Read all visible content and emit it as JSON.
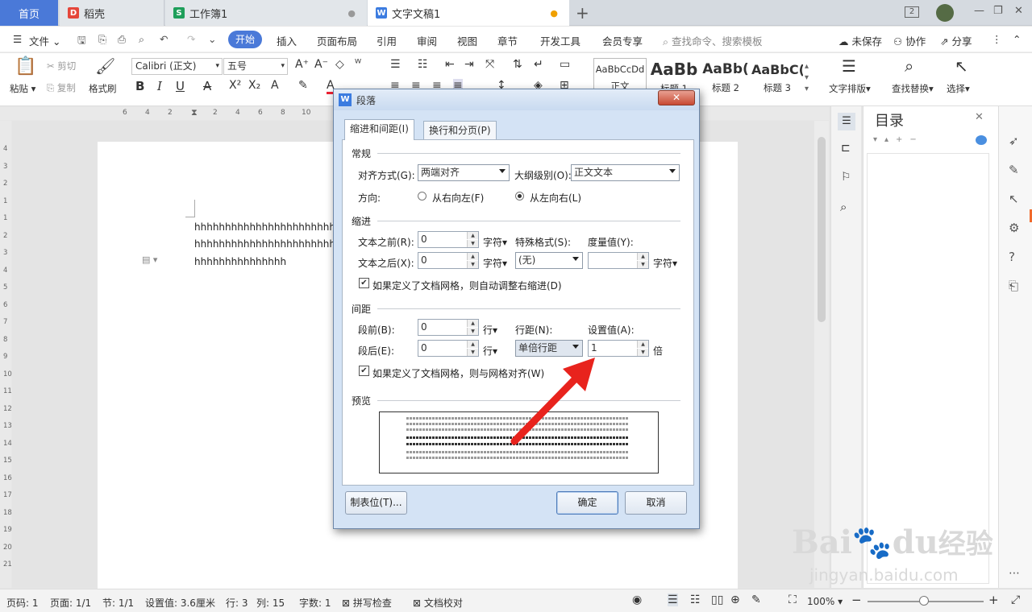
{
  "tabs": {
    "home": "首页",
    "daoke": "稻壳",
    "sheet": "工作簿1",
    "doc": "文字文稿1",
    "window_badge": "2"
  },
  "menubar": {
    "file": "文件",
    "items": [
      "开始",
      "插入",
      "页面布局",
      "引用",
      "审阅",
      "视图",
      "章节",
      "开发工具",
      "会员专享"
    ],
    "search": "查找命令、搜索模板",
    "unsaved": "未保存",
    "collab": "协作",
    "share": "分享"
  },
  "ribbon": {
    "paste": "粘贴",
    "cut": "剪切",
    "copy": "复制",
    "format_painter": "格式刷",
    "font_name": "Calibri (正文)",
    "font_size": "五号",
    "styles": [
      {
        "sample": "AaBbCcDd",
        "name": "正文"
      },
      {
        "sample": "AaBb",
        "name": "标题 1"
      },
      {
        "sample": "AaBb(",
        "name": "标题 2"
      },
      {
        "sample": "AaBbC(",
        "name": "标题 3"
      }
    ],
    "text_layout": "文字排版",
    "find_replace": "查找替换",
    "select": "选择"
  },
  "ruler": {
    "h_ticks": [
      "6",
      "4",
      "2",
      "2",
      "4",
      "6",
      "8",
      "10"
    ],
    "v_ticks": [
      "4",
      "3",
      "2",
      "1",
      "1",
      "2",
      "3",
      "4",
      "5",
      "6",
      "7",
      "8",
      "9",
      "10",
      "11",
      "12",
      "13",
      "14",
      "15",
      "16",
      "17",
      "18",
      "19",
      "20",
      "21"
    ]
  },
  "document": {
    "lines": [
      "hhhhhhhhhhhhhhhhhhhhhhhhh",
      "hhhhhhhhhhhhhhhhhhhhhhhhh",
      "hhhhhhhhhhhhhhh"
    ]
  },
  "toc": {
    "title": "目录"
  },
  "dialog": {
    "title": "段落",
    "tab1": "缩进和间距(I)",
    "tab2": "换行和分页(P)",
    "general": "常规",
    "align_label": "对齐方式(G):",
    "align_value": "两端对齐",
    "outline_label": "大纲级别(O):",
    "outline_value": "正文文本",
    "direction_label": "方向:",
    "rtl": "从右向左(F)",
    "ltr": "从左向右(L)",
    "indent": "缩进",
    "before_text_label": "文本之前(R):",
    "before_text_value": "0",
    "after_text_label": "文本之后(X):",
    "after_text_value": "0",
    "unit_char": "字符",
    "special_label": "特殊格式(S):",
    "special_value": "(无)",
    "measure_label": "度量值(Y):",
    "measure_value": "",
    "grid_indent": "如果定义了文档网格，则自动调整右缩进(D)",
    "spacing": "间距",
    "space_before_label": "段前(B):",
    "space_before_value": "0",
    "space_after_label": "段后(E):",
    "space_after_value": "0",
    "unit_line": "行",
    "line_spacing_label": "行距(N):",
    "line_spacing_value": "单倍行距",
    "setting_label": "设置值(A):",
    "setting_value": "1",
    "unit_times": "倍",
    "grid_align": "如果定义了文档网格，则与网格对齐(W)",
    "preview": "预览",
    "tabs_button": "制表位(T)...",
    "ok": "确定",
    "cancel": "取消"
  },
  "status": {
    "page_no": "页码: 1",
    "pages": "页面: 1/1",
    "section": "节: 1/1",
    "setting": "设置值: 3.6厘米",
    "row": "行: 3",
    "col": "列: 15",
    "words": "字数: 1",
    "spell": "拼写检查",
    "proof": "文档校对",
    "zoom": "100%"
  },
  "watermark": {
    "brand": "Bai",
    "brand2": "du",
    "cn": "经验",
    "url": "jingyan.baidu.com"
  },
  "colors": {
    "accent": "#4a79d8",
    "arrow": "#e8231d"
  }
}
